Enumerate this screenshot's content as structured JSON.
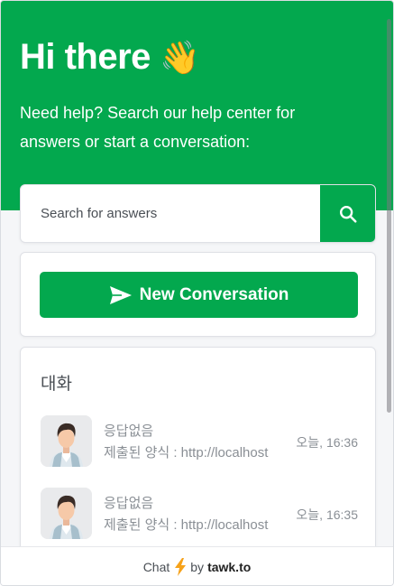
{
  "hero": {
    "title": "Hi there",
    "wave_emoji": "👋",
    "subtitle": "Need help? Search our help center for answers or start a conversation:"
  },
  "search": {
    "placeholder": "Search for answers",
    "icon": "search-icon"
  },
  "new_conversation": {
    "label": "New Conversation",
    "icon": "send-icon"
  },
  "conversations": {
    "title": "대화",
    "items": [
      {
        "name": "응답없음",
        "message": "제출된 양식 : http://localhost",
        "time": "오늘, 16:36",
        "avatar": "agent-avatar"
      },
      {
        "name": "응답없음",
        "message": "제출된 양식 : http://localhost",
        "time": "오늘, 16:35",
        "avatar": "agent-avatar"
      }
    ]
  },
  "footer": {
    "chat_label": "Chat",
    "by_label": "by",
    "brand": "tawk.to",
    "icon": "lightning-icon"
  },
  "colors": {
    "brand_green": "#03a84e",
    "background": "#f5f6f8",
    "muted_text": "#8a8f95"
  }
}
